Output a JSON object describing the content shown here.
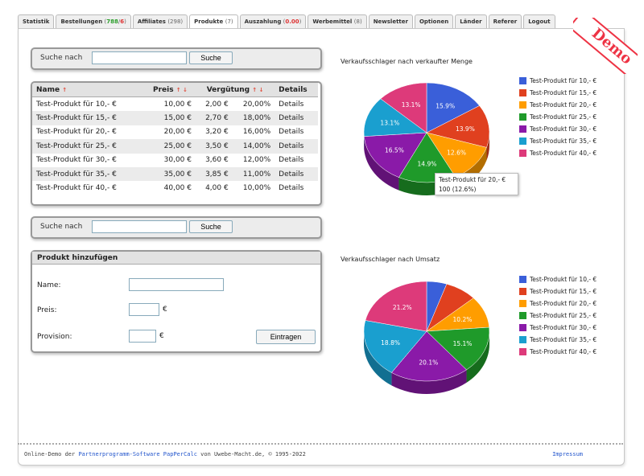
{
  "tabs": [
    {
      "label": "Statistik",
      "count_g": "",
      "count_r": "",
      "count": ""
    },
    {
      "label": "Bestellungen",
      "count_g": "788",
      "count_r": "6",
      "count": ""
    },
    {
      "label": "Affiliates",
      "count": "(298)"
    },
    {
      "label": "Produkte",
      "count": "(7)"
    },
    {
      "label": "Auszahlung",
      "count_g": "",
      "count_r": "0.00",
      "count": ""
    },
    {
      "label": "Werbemittel",
      "count": "(8)"
    },
    {
      "label": "Newsletter",
      "count": ""
    },
    {
      "label": "Optionen",
      "count": ""
    },
    {
      "label": "Länder",
      "count": ""
    },
    {
      "label": "Referer",
      "count": ""
    },
    {
      "label": "Logout",
      "count": ""
    }
  ],
  "demo_label": "Demo",
  "search": {
    "label": "Suche nach",
    "button": "Suche",
    "value": ""
  },
  "table": {
    "headers": [
      "Name",
      "Preis",
      "Vergütung",
      "Details"
    ],
    "sort_arrows": [
      "↑",
      "↑ ↓",
      "↑ ↓"
    ],
    "rows": [
      {
        "name": "Test-Produkt für 10,- €",
        "price": "10,00 €",
        "comm": "2,00 €",
        "pct": "20,00%",
        "details": "Details"
      },
      {
        "name": "Test-Produkt für 15,- €",
        "price": "15,00 €",
        "comm": "2,70 €",
        "pct": "18,00%",
        "details": "Details"
      },
      {
        "name": "Test-Produkt für 20,- €",
        "price": "20,00 €",
        "comm": "3,20 €",
        "pct": "16,00%",
        "details": "Details"
      },
      {
        "name": "Test-Produkt für 25,- €",
        "price": "25,00 €",
        "comm": "3,50 €",
        "pct": "14,00%",
        "details": "Details"
      },
      {
        "name": "Test-Produkt für 30,- €",
        "price": "30,00 €",
        "comm": "3,60 €",
        "pct": "12,00%",
        "details": "Details"
      },
      {
        "name": "Test-Produkt für 35,- €",
        "price": "35,00 €",
        "comm": "3,85 €",
        "pct": "11,00%",
        "details": "Details"
      },
      {
        "name": "Test-Produkt für 40,- €",
        "price": "40,00 €",
        "comm": "4,00 €",
        "pct": "10,00%",
        "details": "Details"
      }
    ]
  },
  "add_product": {
    "title": "Produkt hinzufügen",
    "name_label": "Name:",
    "price_label": "Preis:",
    "commission_label": "Provision:",
    "currency": "€",
    "submit": "Eintragen"
  },
  "colors": [
    "#3a5fd9",
    "#e0401f",
    "#ff9d00",
    "#1f9a2a",
    "#8a1aa8",
    "#1a9fcf",
    "#dd3a7a"
  ],
  "tooltip": {
    "line1": "Test-Produkt für 20,- €",
    "line2": "100 (12.6%)"
  },
  "chart_data": [
    {
      "type": "pie",
      "title": "Verkaufsschlager nach verkaufter Menge",
      "labels": [
        "Test-Produkt für 10,- €",
        "Test-Produkt für 15,- €",
        "Test-Produkt für 20,- €",
        "Test-Produkt für 25,- €",
        "Test-Produkt für 30,- €",
        "Test-Produkt für 35,- €",
        "Test-Produkt für 40,- €"
      ],
      "values": [
        15.9,
        13.9,
        12.6,
        14.9,
        16.5,
        13.1,
        13.1
      ],
      "value_labels": [
        "15.9%",
        "13.9%",
        "12.6%",
        "14.9%",
        "16.5%",
        "13.1%",
        "13.1%"
      ],
      "legend": "right"
    },
    {
      "type": "pie",
      "title": "Verkaufsschlager nach Umsatz",
      "labels": [
        "Test-Produkt für 10,- €",
        "Test-Produkt für 15,- €",
        "Test-Produkt für 20,- €",
        "Test-Produkt für 25,- €",
        "Test-Produkt für 30,- €",
        "Test-Produkt für 35,- €",
        "Test-Produkt für 40,- €"
      ],
      "values": [
        5.1,
        8.1,
        10.2,
        15.1,
        20.1,
        18.8,
        21.2
      ],
      "value_labels": [
        "",
        "",
        "10.2%",
        "15.1%",
        "20.1%",
        "18.8%",
        "21.2%"
      ],
      "legend": "right"
    }
  ],
  "footer": {
    "text_before": "Online-Demo der ",
    "link": "Partnerprogramm-Software PapPerCalc",
    "text_after": " von Uwebe-Macht.de, © 1995-2022",
    "right": "Impressum"
  }
}
